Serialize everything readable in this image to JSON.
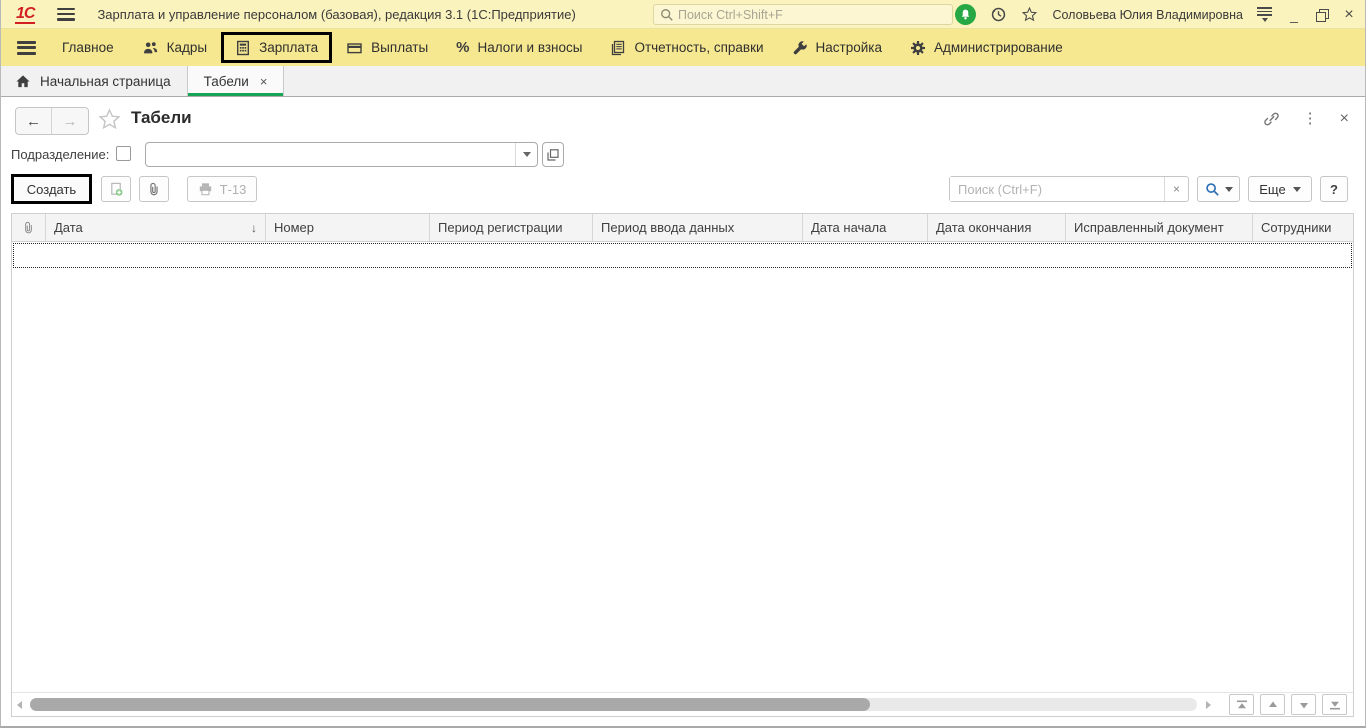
{
  "titlebar": {
    "logo_text": "1С",
    "app_title": "Зарплата и управление персоналом (базовая), редакция 3.1  (1С:Предприятие)",
    "search_placeholder": "Поиск Ctrl+Shift+F",
    "user_name": "Соловьева Юлия Владимировна"
  },
  "menubar": {
    "items": [
      {
        "label": "Главное"
      },
      {
        "label": "Кадры"
      },
      {
        "label": "Зарплата",
        "highlighted": true
      },
      {
        "label": "Выплаты"
      },
      {
        "label": "Налоги и взносы"
      },
      {
        "label": "Отчетность, справки"
      },
      {
        "label": "Настройка"
      },
      {
        "label": "Администрирование"
      }
    ]
  },
  "tabbar": {
    "home_tab": "Начальная страница",
    "active_tab": "Табели"
  },
  "form": {
    "title": "Табели",
    "department_label": "Подразделение:",
    "department_value": "",
    "toolbar": {
      "create_label": "Создать",
      "t13_label": "Т-13",
      "search_placeholder": "Поиск (Ctrl+F)",
      "more_label": "Еще",
      "help_label": "?"
    },
    "table": {
      "columns": [
        "Дата",
        "Номер",
        "Период регистрации",
        "Период ввода данных",
        "Дата начала",
        "Дата окончания",
        "Исправленный документ",
        "Сотрудники"
      ],
      "sort_column": "Дата",
      "rows": []
    }
  },
  "glyphs": {
    "close": "×",
    "minimize": "_",
    "dots": "⋮",
    "back": "←",
    "forward": "→",
    "percent": "%",
    "sort_down": "↓",
    "clear": "×",
    "tab_close": "×"
  },
  "colors": {
    "titlebar_bg": "#fbf3bd",
    "menubar_bg": "#f6e890",
    "tab_underline": "#18a457",
    "highlight_border": "#000000",
    "bell_green": "#27a844",
    "magnifier_blue": "#2f6fb5",
    "logo_red": "#d21f26"
  }
}
